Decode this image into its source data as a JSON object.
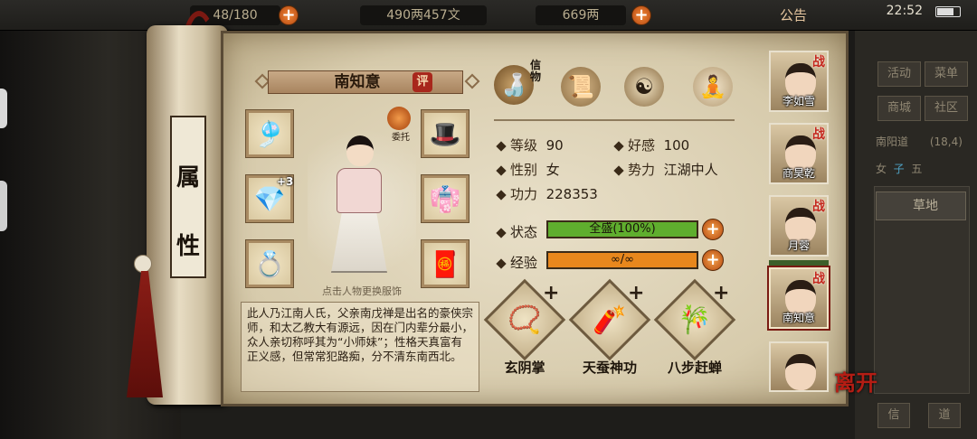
{
  "topbar": {
    "capacity": "48/180",
    "money": "490两457文",
    "gold": "669两",
    "notice": "公告",
    "time": "22:52"
  },
  "right_panel": {
    "buttons": [
      "活动",
      "菜单",
      "商城",
      "社区"
    ],
    "location": "南阳道",
    "location_coords": "(18,4)",
    "time_row": [
      "女",
      "子",
      "五"
    ],
    "terrain": "草地",
    "bottom_buttons": [
      "信",
      "道"
    ]
  },
  "scroll_rod": {
    "chars": [
      "属",
      "性"
    ]
  },
  "character": {
    "name": "南知意",
    "rate_badge": "评",
    "entrust_label": "委托",
    "equip_plus": "+3",
    "hint": "点击人物更换服饰",
    "bio": "此人乃江南人氏，父亲南戊禅是出名的豪侠宗师，和太乙教大有源远，因在门内辈分最小，众人亲切称呼其为“小师妹”；性格天真富有正义感，但常常犯路痴，分不清东南西北。"
  },
  "top_icons": {
    "xinyin": "信物"
  },
  "stats": {
    "level_label": "等级",
    "level": "90",
    "favor_label": "好感",
    "favor": "100",
    "gender_label": "性别",
    "gender": "女",
    "faction_label": "势力",
    "faction": "江湖中人",
    "power_label": "功力",
    "power": "228353"
  },
  "bars": {
    "status_label": "状态",
    "status_text": "全盛(100%)",
    "status_fill": 1.0,
    "exp_label": "经验",
    "exp_text": "∞/∞",
    "exp_fill": 1.0,
    "status_color": "#5fae2e",
    "exp_color": "#e8871d"
  },
  "skills": [
    {
      "name": "玄阴掌",
      "plus": "+"
    },
    {
      "name": "天蚕神功",
      "plus": "+"
    },
    {
      "name": "八步赶蝉",
      "plus": "+"
    }
  ],
  "portraits": [
    {
      "name": "李如雪",
      "tag": "战"
    },
    {
      "name": "商昊乾",
      "tag": "战"
    },
    {
      "name": "月蓉",
      "tag": "战"
    },
    {
      "name": "南知意",
      "tag": "战"
    },
    {
      "name": "",
      "tag": ""
    }
  ],
  "leave_label": "离开"
}
